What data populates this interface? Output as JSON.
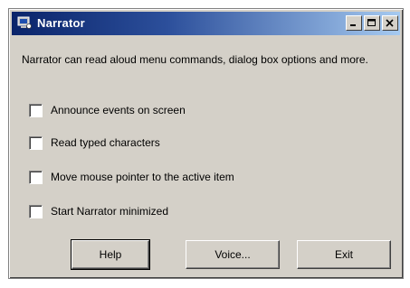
{
  "window": {
    "title": "Narrator",
    "minimize_label": "_",
    "maximize_label": "□",
    "close_label": "X"
  },
  "description": "Narrator can read aloud menu commands, dialog box options and more.",
  "options": [
    {
      "label": "Announce events on screen",
      "checked": false
    },
    {
      "label": "Read typed characters",
      "checked": false
    },
    {
      "label": "Move mouse pointer to the active item",
      "checked": false
    },
    {
      "label": "Start Narrator minimized",
      "checked": false
    }
  ],
  "buttons": {
    "help": "Help",
    "voice": "Voice...",
    "exit": "Exit"
  },
  "colors": {
    "titlebar_start": "#0a246a",
    "titlebar_end": "#a6caf0",
    "face": "#d4d0c8"
  }
}
